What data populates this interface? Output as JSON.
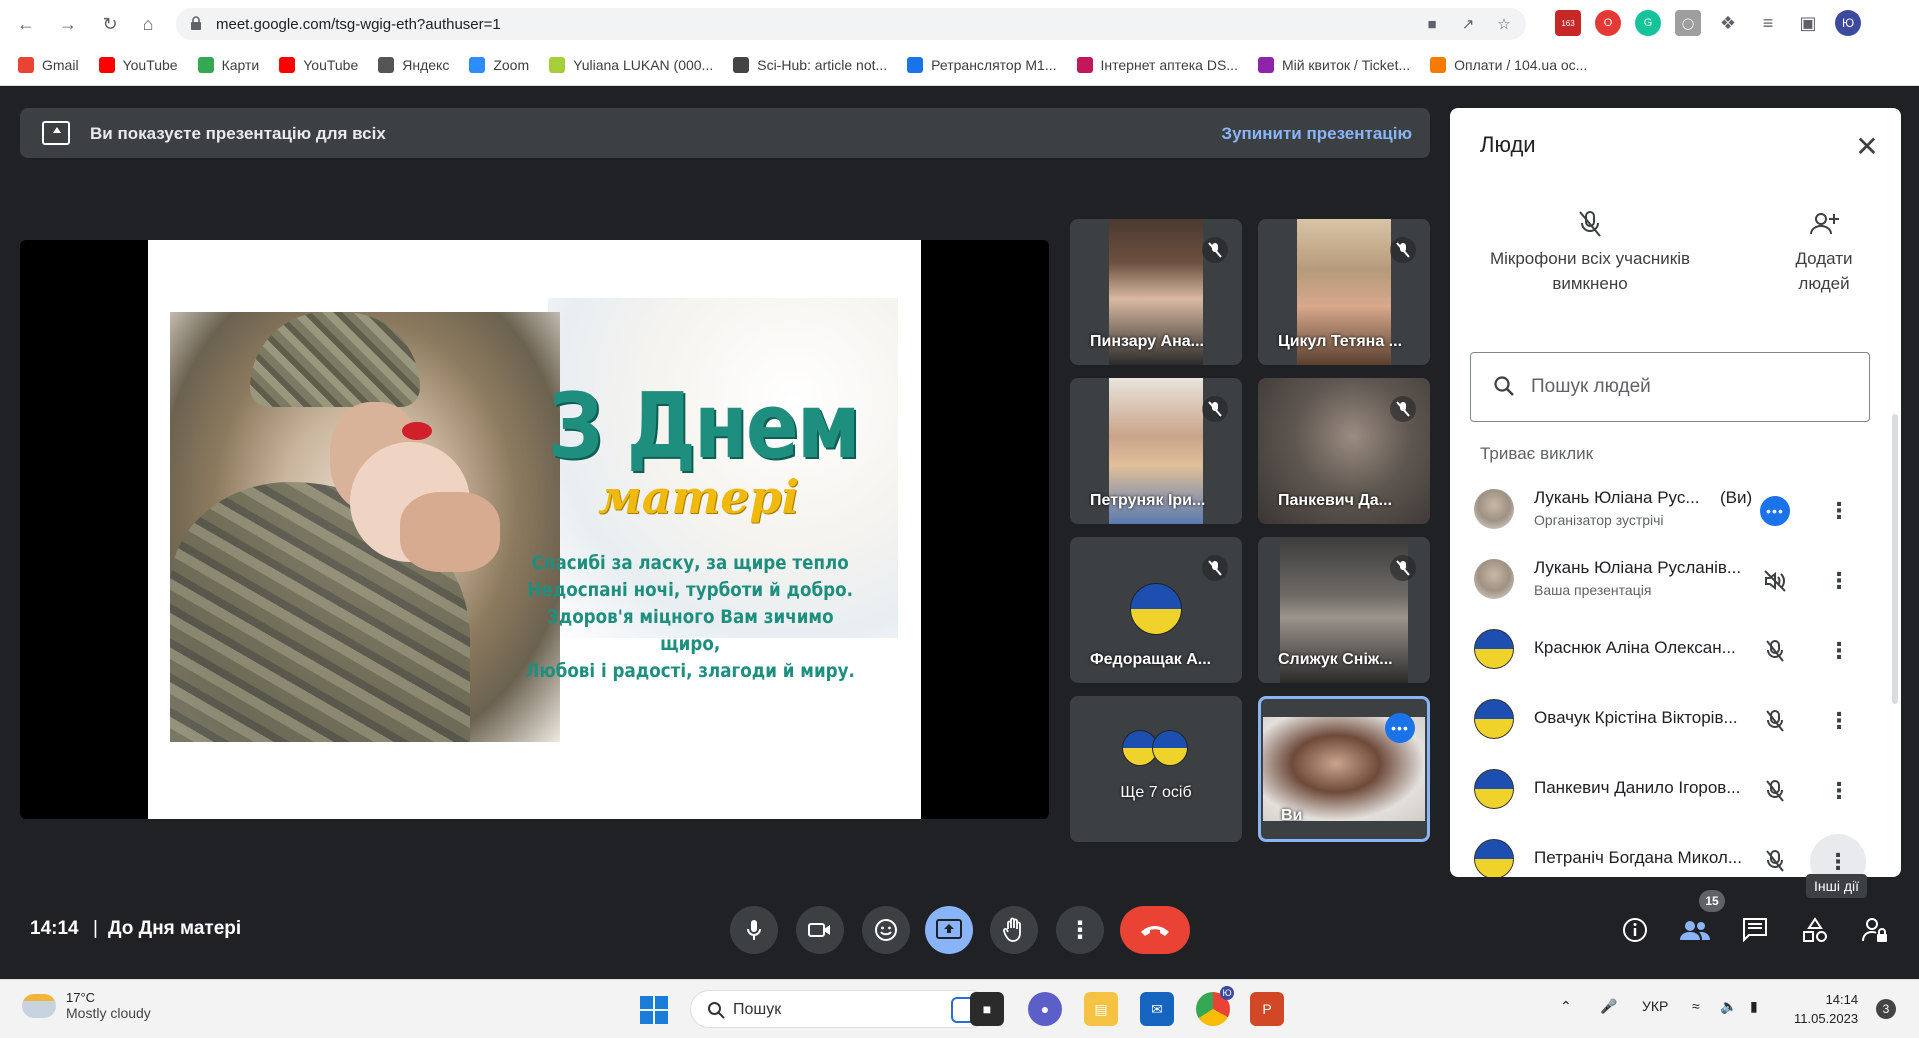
{
  "browser": {
    "url": "meet.google.com/tsg-wgig-eth?authuser=1",
    "profile_initials": "Ю",
    "ext_badge": "163",
    "bookmarks": [
      {
        "label": "Gmail",
        "color": "#ea4335"
      },
      {
        "label": "YouTube",
        "color": "#ff0000"
      },
      {
        "label": "Карти",
        "color": "#34a853"
      },
      {
        "label": "YouTube",
        "color": "#ff0000"
      },
      {
        "label": "Яндекс",
        "color": "#555555"
      },
      {
        "label": "Zoom",
        "color": "#2d8cff"
      },
      {
        "label": "Yuliana LUKAN (000...",
        "color": "#a6ce39"
      },
      {
        "label": "Sci-Hub: article not...",
        "color": "#444444"
      },
      {
        "label": "Ретранслятор М1...",
        "color": "#1a73e8"
      },
      {
        "label": "Інтернет аптека DS...",
        "color": "#c2185b"
      },
      {
        "label": "Мій квиток / Ticket...",
        "color": "#8e24aa"
      },
      {
        "label": "Оплати / 104.ua ос...",
        "color": "#f57c00"
      }
    ]
  },
  "banner": {
    "text": "Ви показуєте презентацію для всіх",
    "stop_label": "Зупинити презентацію"
  },
  "slide": {
    "title": "З Днем",
    "subtitle": "матері",
    "poem": [
      "Спасибі за ласку, за щире тепло",
      "Недоспані ночі, турботи й добро.",
      "Здоров'я міцного Вам зичимо щиро,",
      "Любові і радості, злагоди й миру."
    ]
  },
  "tiles": [
    {
      "name": "Пинзару Ана..."
    },
    {
      "name": "Цикул Тетяна ..."
    },
    {
      "name": "Петруняк Іри..."
    },
    {
      "name": "Панкевич Да..."
    },
    {
      "name": "Федоращак А..."
    },
    {
      "name": "Слижук Сніж..."
    },
    {
      "name": "Ще 7 осіб"
    },
    {
      "name": "Ви"
    }
  ],
  "panel": {
    "title": "Люди",
    "mute_all_label": "Мікрофони всіх учасників вимкнено",
    "add_people_label": "Додати людей",
    "search_placeholder": "Пошук людей",
    "section": "Триває виклик",
    "people": [
      {
        "name": "Лукань Юліана Рус...",
        "you": "(Ви)",
        "sub": "Організатор зустрічі"
      },
      {
        "name": "Лукань Юліана Русланів...",
        "sub": "Ваша презентація"
      },
      {
        "name": "Краснюк Аліна Олексан...",
        "sub": ""
      },
      {
        "name": "Овачук Крістіна Вікторів...",
        "sub": ""
      },
      {
        "name": "Панкевич Данило Ігоров...",
        "sub": ""
      },
      {
        "name": "Петраніч Богдана Микол...",
        "sub": ""
      }
    ]
  },
  "tooltip": "Інші дії",
  "bottom": {
    "time": "14:14",
    "separator": "|",
    "meeting_name": "До Дня матері",
    "participants_count": "15"
  },
  "taskbar": {
    "temp": "17°C",
    "weather": "Mostly cloudy",
    "search_placeholder": "Пошук",
    "lang": "УКР",
    "time": "14:14",
    "date": "11.05.2023",
    "notifications": "3",
    "chrome_badge": "Ю"
  }
}
